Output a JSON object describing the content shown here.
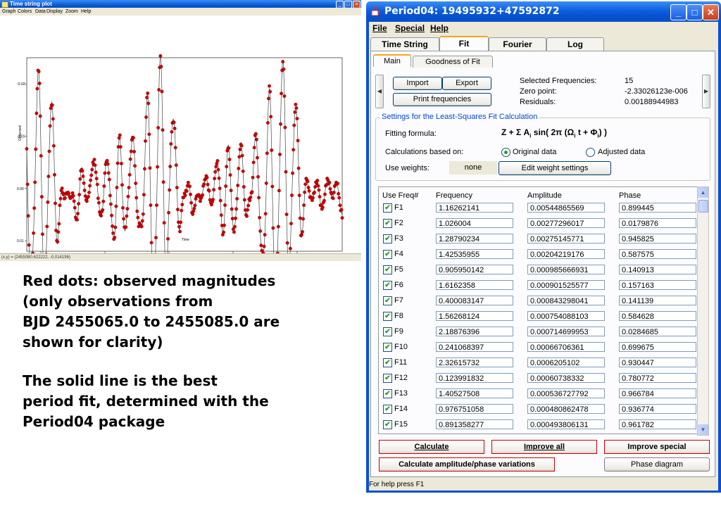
{
  "plot_window": {
    "title": "Time string plot",
    "menu": [
      "Graph",
      "Colors",
      "Data",
      "Display",
      "Zoom",
      "Help"
    ],
    "y_axis_label": "Observed",
    "x_axis_label": "Time",
    "y_ticks": [
      "-0.02",
      "-0.01",
      "0.00",
      "0.01"
    ],
    "x_ticks": [
      "2.5e+006",
      "2.5e+006",
      "2.5e+006",
      "2.5e+006",
      "2.5e+006"
    ],
    "status": "(x,y) = (2455080.622222, -0.014196)",
    "colors": {
      "dots": "#cc0000",
      "line": "#444444"
    }
  },
  "annotation": {
    "para1": "Red dots: observed magnitudes\n(only observations from\nBJD 2455065.0 to 2455085.0 are\nshown for clarity)",
    "para2": "The solid line is the best\nperiod fit, determined with the\nPeriod04 package"
  },
  "period04": {
    "title": "Period04: 19495932+47592872",
    "menu": {
      "file": "File",
      "special": "Special",
      "help": "Help"
    },
    "tabs": [
      "Time String",
      "Fit",
      "Fourier",
      "Log"
    ],
    "subtabs": [
      "Main",
      "Goodness of Fit"
    ],
    "buttons": {
      "import": "Import",
      "export": "Export",
      "print": "Print frequencies"
    },
    "summary": {
      "selected_label": "Selected Frequencies:",
      "selected_value": "15",
      "zero_label": "Zero point:",
      "zero_value": "-2.33026123e-006",
      "residuals_label": "Residuals:",
      "residuals_value": "0.00188944983"
    },
    "settings": {
      "legend": "Settings for the Least-Squares Fit Calculation",
      "formula_label": "Fitting formula:",
      "based_label": "Calculations based on:",
      "original": "Original data",
      "adjusted": "Adjusted data",
      "weights_label": "Use weights:",
      "weights_value": "none",
      "edit_weights": "Edit weight settings"
    },
    "table": {
      "headers": [
        "Use Freq#",
        "Frequency",
        "Amplitude",
        "Phase"
      ],
      "rows": [
        {
          "id": "F1",
          "freq": "1.16262141",
          "amp": "0.00544865569",
          "phase": "0.899445"
        },
        {
          "id": "F2",
          "freq": "1.026004",
          "amp": "0.00277296017",
          "phase": "0.0179876"
        },
        {
          "id": "F3",
          "freq": "1.28790234",
          "amp": "0.00275145771",
          "phase": "0.945825"
        },
        {
          "id": "F4",
          "freq": "1.42535955",
          "amp": "0.00204219176",
          "phase": "0.587575"
        },
        {
          "id": "F5",
          "freq": "0.905950142",
          "amp": "0.000985666931",
          "phase": "0.140913"
        },
        {
          "id": "F6",
          "freq": "1.6162358",
          "amp": "0.000901525577",
          "phase": "0.157163"
        },
        {
          "id": "F7",
          "freq": "0.400083147",
          "amp": "0.000843298041",
          "phase": "0.141139"
        },
        {
          "id": "F8",
          "freq": "1.56268124",
          "amp": "0.000754088103",
          "phase": "0.584628"
        },
        {
          "id": "F9",
          "freq": "2.18876396",
          "amp": "0.000714699953",
          "phase": "0.0284685"
        },
        {
          "id": "F10",
          "freq": "0.241068397",
          "amp": "0.00066706361",
          "phase": "0.699675"
        },
        {
          "id": "F11",
          "freq": "2.32615732",
          "amp": "0.0006205102",
          "phase": "0.930447"
        },
        {
          "id": "F12",
          "freq": "0.123991832",
          "amp": "0.00060738332",
          "phase": "0.780772"
        },
        {
          "id": "F13",
          "freq": "1.40527508",
          "amp": "0.000536727792",
          "phase": "0.966784"
        },
        {
          "id": "F14",
          "freq": "0.976751058",
          "amp": "0.000480862478",
          "phase": "0.936774"
        },
        {
          "id": "F15",
          "freq": "0.891358277",
          "amp": "0.000493806131",
          "phase": "0.961782"
        }
      ]
    },
    "actions": {
      "calculate": "Calculate",
      "improve_all": "Improve all",
      "improve_special": "Improve special",
      "calc_amp_phase": "Calculate amplitude/phase variations",
      "phase_diagram": "Phase diagram"
    },
    "status": "For help press F1"
  }
}
